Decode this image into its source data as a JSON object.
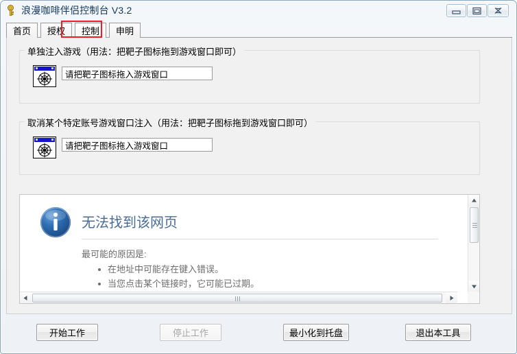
{
  "window": {
    "title": "浪漫咖啡伴侣控制台 V3.2",
    "icon": "key-icon",
    "controls": {
      "minimize": "minimize-icon",
      "maximize": "maximize-icon",
      "close": "close-icon"
    }
  },
  "tabs": [
    {
      "label": "首页",
      "active": false
    },
    {
      "label": "授权",
      "active": false
    },
    {
      "label": "控制",
      "active": true,
      "highlighted": true
    },
    {
      "label": "申明",
      "active": false
    }
  ],
  "groups": [
    {
      "legend": "单独注入游戏（用法：把靶子图标拖到游戏窗口即可）",
      "icon": "target-window-icon",
      "input_value": "请把靶子图标拖入游戏窗口"
    },
    {
      "legend": "取消某个特定账号游戏窗口注入（用法：把靶子图标拖到游戏窗口即可）",
      "icon": "target-window-icon",
      "input_value": "请把靶子图标拖入游戏窗口"
    }
  ],
  "browser": {
    "icon": "info-icon",
    "title": "无法找到该网页",
    "reason_heading": "最可能的原因是:",
    "reasons": [
      "在地址中可能存在键入错误。",
      "当您点击某个链接时，它可能已过期。"
    ],
    "scroll": {
      "vertical": "vertical-scrollbar",
      "horizontal": "horizontal-scrollbar"
    }
  },
  "footer": {
    "buttons": [
      {
        "label": "开始工作",
        "disabled": false
      },
      {
        "label": "停止工作",
        "disabled": true
      },
      {
        "label": "最小化到托盘",
        "disabled": false
      },
      {
        "label": "退出本工具",
        "disabled": false
      }
    ]
  },
  "colors": {
    "highlight": "#ee1c25",
    "title_text": "#13375e",
    "error_title": "#4a6b93",
    "error_body": "#6d6d6d",
    "target_titlebar": "#1414c8"
  }
}
